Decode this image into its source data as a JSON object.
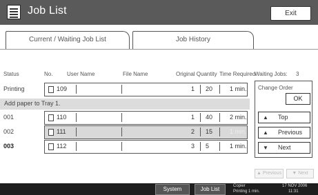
{
  "header": {
    "title": "Job List",
    "exit_label": "Exit"
  },
  "tabs": [
    {
      "label": "Current / Waiting Job List",
      "active": true
    },
    {
      "label": "Job History",
      "active": false
    }
  ],
  "columns": {
    "status": "Status",
    "no": "No.",
    "user_name": "User Name",
    "file_name": "File Name",
    "originals_qty": "Original Quantity",
    "time_required": "Time Required"
  },
  "jobs": [
    {
      "status": "Printing",
      "no": "109",
      "user_name": "",
      "file_name": "",
      "originals": "1",
      "qty": "20",
      "time": "1 min.",
      "highlight": false
    },
    {
      "status": "001",
      "no": "110",
      "user_name": "",
      "file_name": "",
      "originals": "1",
      "qty": "40",
      "time": "2 min.",
      "highlight": false
    },
    {
      "status": "002",
      "no": "111",
      "user_name": "",
      "file_name": "",
      "originals": "2",
      "qty": "15",
      "time": "1 min.",
      "highlight": true
    },
    {
      "status": "003",
      "no": "112",
      "user_name": "",
      "file_name": "",
      "originals": "3",
      "qty": "5",
      "time": "1 min.",
      "highlight": false
    }
  ],
  "message_row": "Add paper to Tray 1.",
  "waiting": {
    "label": "Waiting Jobs:",
    "count": "3"
  },
  "side_panel": {
    "change_order": "Change Order",
    "ok": "OK",
    "top": "Top",
    "previous": "Previous",
    "next": "Next"
  },
  "pager": {
    "previous": "Previous",
    "next": "Next"
  },
  "footer": {
    "system_status": "System Status",
    "job_list": "Job List",
    "status_line1": "Copier",
    "status_line2": "Printing  1 min.",
    "date": "17 NOV  2006",
    "time": "11:31"
  }
}
